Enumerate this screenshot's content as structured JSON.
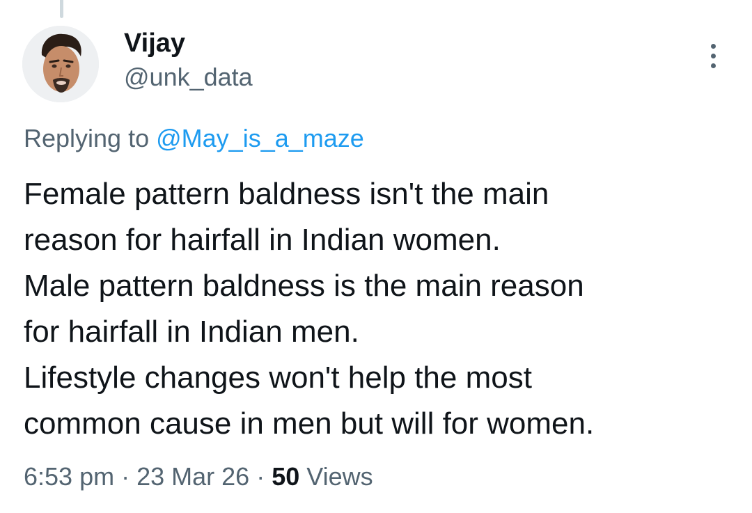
{
  "tweet": {
    "author": {
      "name": "Vijay",
      "handle": "@unk_data"
    },
    "reply": {
      "prefix": "Replying to",
      "mention": "@May_is_a_maze"
    },
    "text_lines": [
      "Female pattern baldness isn't the main",
      "reason for hairfall in Indian women.",
      "Male pattern baldness is the main reason",
      "for hairfall in Indian men.",
      "Lifestyle changes won't help the most",
      "common cause in men but will for women."
    ],
    "meta": {
      "time": "6:53 pm",
      "date": "23 Mar 26",
      "separator": "·",
      "views_count": "50",
      "views_label": "Views"
    }
  },
  "icons": {
    "more": "more-vertical-icon",
    "avatar": "avatar-image"
  },
  "colors": {
    "text": "#0f1419",
    "secondary": "#536471",
    "link": "#1d9bf0"
  }
}
